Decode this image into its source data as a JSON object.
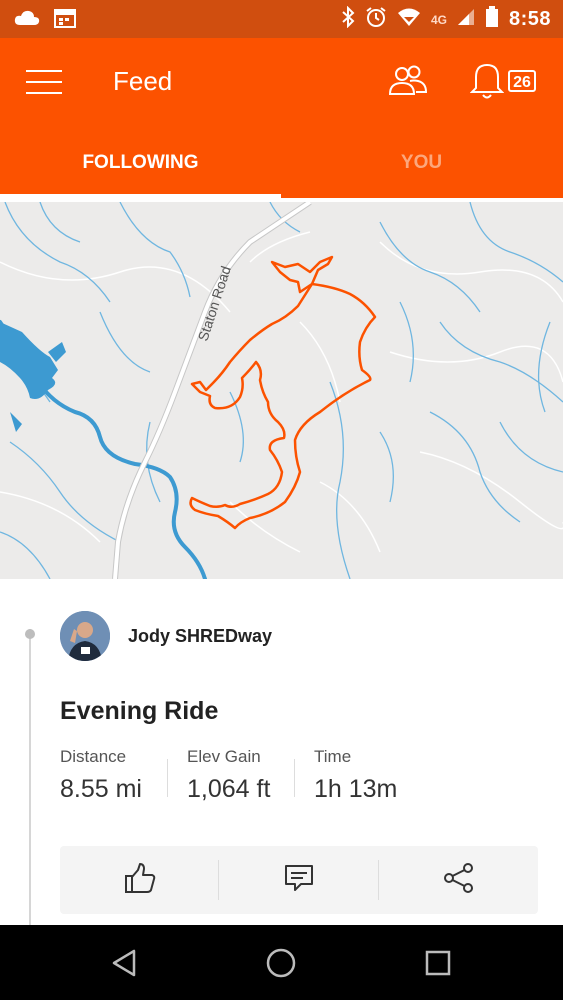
{
  "status_bar": {
    "time": "8:58",
    "network": "4G",
    "icons": [
      "cloud-icon",
      "calendar-icon",
      "bluetooth-icon",
      "alarm-icon",
      "wifi-icon",
      "signal-icon",
      "battery-icon"
    ]
  },
  "app_bar": {
    "title": "Feed",
    "notification_count": "26",
    "icons": [
      "menu-icon",
      "friends-icon",
      "bell-icon"
    ]
  },
  "tabs": [
    {
      "label": "FOLLOWING",
      "active": true
    },
    {
      "label": "YOU",
      "active": false
    }
  ],
  "map": {
    "road_label": "Staton Road",
    "route_color": "#fc5200",
    "water_color": "#3d9ad1",
    "land_color": "#ecebea"
  },
  "activity": {
    "athlete_name": "Jody SHREDway",
    "title": "Evening Ride",
    "stats": [
      {
        "label": "Distance",
        "value": "8.55 mi"
      },
      {
        "label": "Elev Gain",
        "value": "1,064 ft"
      },
      {
        "label": "Time",
        "value": "1h 13m"
      }
    ],
    "actions": [
      "thumbs-up-icon",
      "comment-icon",
      "share-icon"
    ]
  },
  "nav_bar": {
    "icons": [
      "back-icon",
      "home-icon",
      "recents-icon"
    ]
  },
  "colors": {
    "accent": "#fc5200",
    "status_bar": "#d04e0f"
  }
}
